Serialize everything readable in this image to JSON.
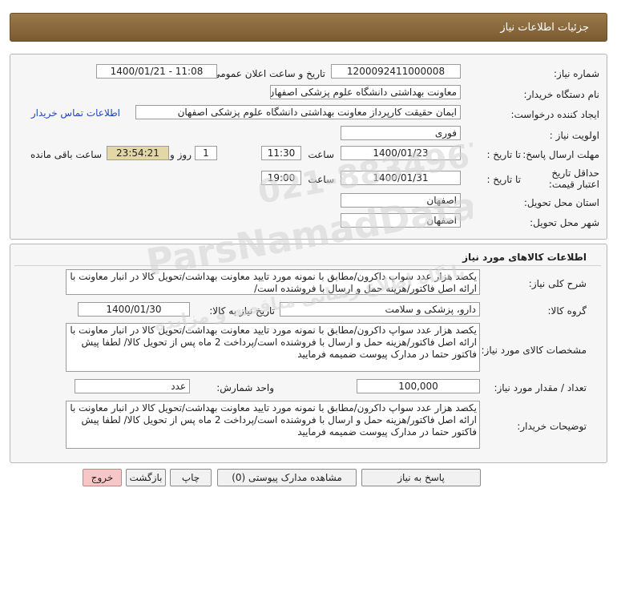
{
  "header": {
    "title": "جزئیات اطلاعات نیاز"
  },
  "need_info": {
    "need_number_label": "شماره نیاز:",
    "need_number": "1200092411000008",
    "announce_label": "تاریخ و ساعت اعلان عمومی:",
    "announce_value": "1400/01/21 - 11:08",
    "buyer_org_label": "نام دستگاه خریدار:",
    "buyer_org": "معاونت بهداشتی دانشگاه علوم پزشکی اصفهان",
    "requester_label": "ایجاد کننده درخواست:",
    "requester": "ایمان حقیقت کارپرداز معاونت بهداشتی دانشگاه علوم پزشکی اصفهان",
    "contact_link": "اطلاعات تماس خریدار",
    "priority_label": "اولویت نیاز :",
    "priority": "فوری",
    "send_deadline_label": "مهلت ارسال پاسخ:",
    "to_date_label": "تا تاریخ :",
    "send_date": "1400/01/23",
    "time_label": "ساعت",
    "send_time": "11:30",
    "days_value": "1",
    "days_label": "روز و",
    "remaining_time": "23:54:21",
    "remaining_label": "ساعت باقی مانده",
    "validity_label": "حداقل تاریخ اعتبار قیمت:",
    "validity_to_label": "تا تاریخ :",
    "validity_date": "1400/01/31",
    "validity_time_label": "ساعت",
    "validity_time": "19:00",
    "province_label": "استان محل تحویل:",
    "province": "اصفهان",
    "city_label": "شهر محل تحویل:",
    "city": "اصفهان"
  },
  "goods": {
    "section_title": "اطلاعات کالاهای مورد نیاز",
    "general_desc_label": "شرح کلی نیاز:",
    "general_desc": "یکصد هزار عدد سواپ داکرون/مطابق با نمونه مورد تایید معاونت بهداشت/تحویل کالا در انبار معاونت با ارائه اصل فاکتور/هزینه حمل و ارسال با فروشنده است/",
    "group_label": "گروه کالا:",
    "group": "دارو، پزشکی و سلامت",
    "need_date_label": "تاریخ نیاز به کالا:",
    "need_date": "1400/01/30",
    "specs_label": "مشخصات کالای مورد نیاز:",
    "specs": "یکصد هزار عدد سواپ داکرون/مطابق با نمونه مورد تایید معاونت بهداشت/تحویل کالا در انبار معاونت با ارائه اصل فاکتور/هزینه حمل و ارسال با فروشنده است/پرداخت 2 ماه پس از تحویل کالا/ لطفا پیش فاکتور حتما در مدارک پیوست ضمیمه فرمایید",
    "quantity_label": "تعداد / مقدار مورد نیاز:",
    "quantity": "100,000",
    "unit_label": "واحد شمارش:",
    "unit": "عدد",
    "buyer_notes_label": "توضیحات خریدار:",
    "buyer_notes": "یکصد هزار عدد سواپ داکرون/مطابق با نمونه مورد تایید معاونت بهداشت/تحویل کالا در انبار معاونت با ارائه اصل فاکتور/هزینه حمل و ارسال با فروشنده است/پرداخت 2 ماه پس از تحویل کالا/ لطفا پیش فاکتور حتما در مدارک پیوست ضمیمه فرمایید"
  },
  "buttons": {
    "reply": "پاسخ به نیاز",
    "view_attachments": "مشاهده مدارک پیوستی (0)",
    "print": "چاپ",
    "back": "بازگشت",
    "exit": "خروج"
  },
  "watermark": {
    "line1": "ParsNamadData",
    "line2": "پایگاه اطلاع رسانی مناقصه و مزایده",
    "phone": "021-88349670"
  }
}
